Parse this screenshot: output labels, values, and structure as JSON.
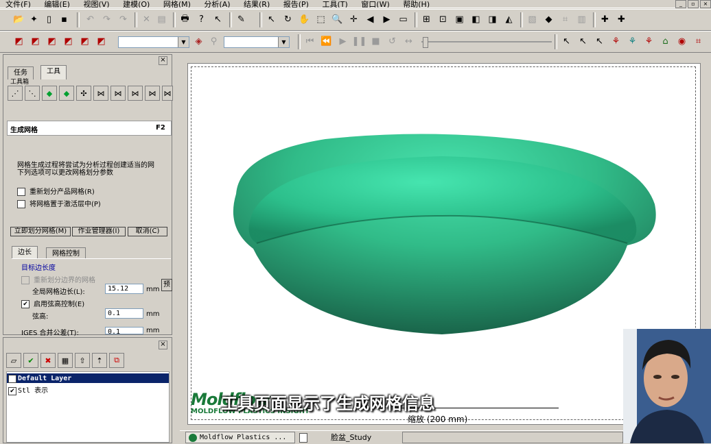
{
  "menu": [
    "文件(F)",
    "编辑(E)",
    "视图(V)",
    "建模(O)",
    "网格(M)",
    "分析(A)",
    "结果(R)",
    "报告(P)",
    "工具(T)",
    "窗口(W)",
    "帮助(H)"
  ],
  "left_panel": {
    "tabs": [
      "任务",
      "工具"
    ],
    "toolbox_label": "工具箱",
    "section_title": "生成网格",
    "shortcut": "F2",
    "description_1": "网格生成过程将尝试为分析过程创建适当的网",
    "description_2": "下列选项可以更改网格划分参数",
    "option_remesh": "重新划分产品网格(R)",
    "option_activelayer": "将网格置于激活层中(P)",
    "buttons": {
      "mesh_now": "立即划分网格(M)",
      "job_manager": "作业管理器(I)",
      "cancel": "取消(C)"
    },
    "subtabs": [
      "边长",
      "网格控制"
    ],
    "group_title": "目标边长度",
    "remesh_boundary": "重新划分边界的网格",
    "global_edge_label": "全局网格边长(L):",
    "global_edge_value": "15.12",
    "unit_mm": "mm",
    "preview_button": "预",
    "chord_control_label": "启用弦高控制(E)",
    "chord_label": "弦高:",
    "chord_value": "0.1",
    "iges_label": "IGES 合并公差(T):",
    "iges_value": "0.1"
  },
  "layers": {
    "items": [
      {
        "name": "Default Layer",
        "checked": "✔"
      },
      {
        "name": "Stl 表示",
        "checked": "✔"
      }
    ]
  },
  "viewport": {
    "scale_label": "缩放 (200 mm)",
    "logo_text": "Moldflow",
    "logo_subtext": "MOLDFLOW PLASTICS INSIGHT"
  },
  "bottom_tabs": [
    "Moldflow Plastics ...",
    "脸盆_Study"
  ],
  "subtitle": "工具页面显示了生成网格信息",
  "colors": {
    "model_green": "#2fb888",
    "selected_row": "#0a246a",
    "toolbar_bg": "#d4d0c8"
  }
}
